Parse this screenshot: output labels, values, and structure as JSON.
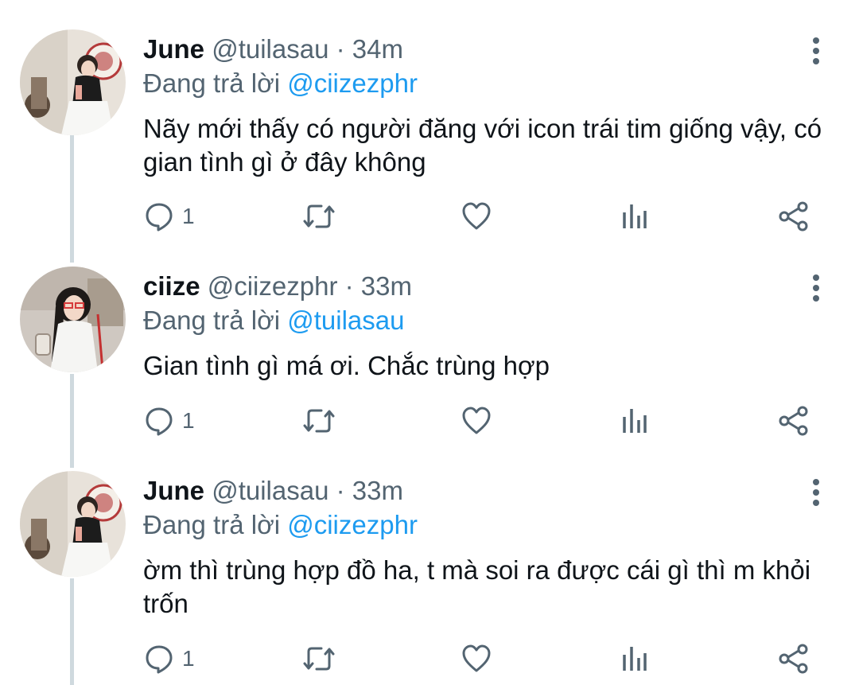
{
  "colors": {
    "text": "#0f1419",
    "secondary": "#536471",
    "accent": "#1d9bf0",
    "thread_line": "#cfd9de"
  },
  "tweets": [
    {
      "name": "June",
      "handle": "@tuilasau",
      "dot": "·",
      "time": "34m",
      "replying_prefix": "Đang trả lời",
      "replying_to": "@ciizezphr",
      "text": "Nãy mới thấy có người đăng với icon trái tim giống vậy, có gian tình gì ở đây không",
      "reply_count": "1",
      "avatar": "june-avatar"
    },
    {
      "name": "ciize",
      "handle": "@ciizezphr",
      "dot": "·",
      "time": "33m",
      "replying_prefix": "Đang trả lời",
      "replying_to": "@tuilasau",
      "text": "Gian tình gì má ơi. Chắc trùng hợp",
      "reply_count": "1",
      "avatar": "ciize-avatar"
    },
    {
      "name": "June",
      "handle": "@tuilasau",
      "dot": "·",
      "time": "33m",
      "replying_prefix": "Đang trả lời",
      "replying_to": "@ciizezphr",
      "text": "ờm thì trùng hợp đồ ha, t mà soi ra được cái gì thì m khỏi trốn",
      "reply_count": "1",
      "avatar": "june-avatar"
    }
  ],
  "icons": {
    "reply": "reply-icon",
    "retweet": "retweet-icon",
    "like": "heart-icon",
    "views": "analytics-icon",
    "share": "share-icon",
    "more": "more-vertical-icon"
  }
}
